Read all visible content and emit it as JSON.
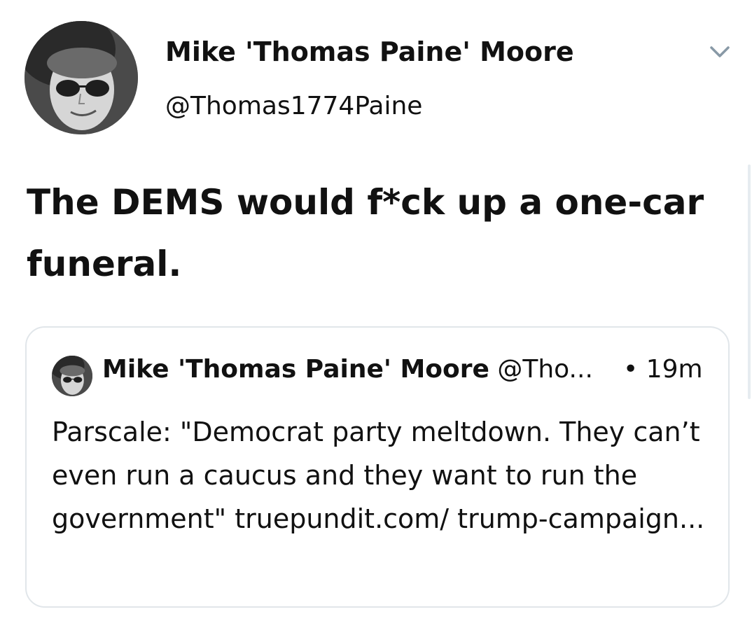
{
  "tweet": {
    "author": {
      "display_name": "Mike 'Thomas Paine' Moore",
      "handle": "@Thomas1774Paine",
      "avatar_icon": "avatar-sunglasses-portrait"
    },
    "menu_icon": "chevron-down-icon",
    "text": "The DEMS would f*ck up a one-car funeral.",
    "quoted_tweet": {
      "display_name": "Mike 'Thomas Paine' Moore",
      "handle_truncated": "@Tho...",
      "separator": "•",
      "time": "19m",
      "text": "Parscale: \"Democrat party meltdown. They can’t even run a caucus and they want to run the government\" truepundit.com/ trump-campaign..."
    }
  },
  "colors": {
    "text": "#111111",
    "card_border": "#e1e6ea",
    "chevron": "#8899a6",
    "background": "#ffffff"
  }
}
